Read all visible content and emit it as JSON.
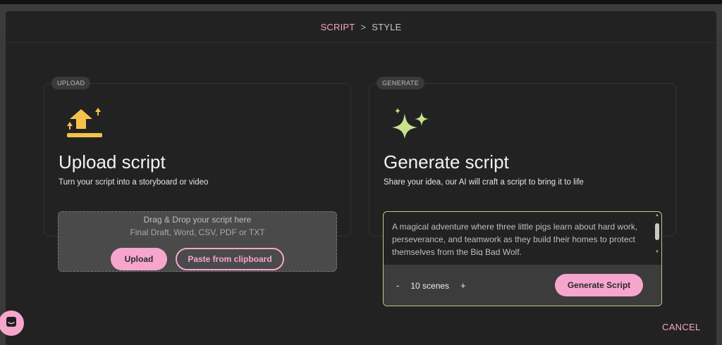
{
  "breadcrumb": {
    "step1": "SCRIPT",
    "separator": ">",
    "step2": "STYLE"
  },
  "upload_card": {
    "badge": "UPLOAD",
    "icon": "upload-arrow-icon",
    "title": "Upload script",
    "subtitle": "Turn your script into a storyboard or video",
    "dropzone_line1": "Drag & Drop your script here",
    "dropzone_line2": "Final Draft, Word, CSV, PDF or TXT",
    "upload_label": "Upload",
    "paste_label": "Paste from clipboard"
  },
  "generate_card": {
    "badge": "GENERATE",
    "icon": "sparkles-icon",
    "title": "Generate script",
    "subtitle": "Share your idea, our AI will craft a script to bring it to life",
    "idea_text": "A magical adventure where three little pigs learn about hard work, perseverance, and teamwork as they build their homes to protect themselves from the Big Bad Wolf.",
    "decrement_label": "-",
    "scenes_label": "10 scenes",
    "increment_label": "+",
    "generate_label": "Generate Script"
  },
  "footer": {
    "cancel_label": "CANCEL"
  },
  "chat": {
    "icon": "chat-icon"
  },
  "colors": {
    "accent": "#f6a6cc",
    "icon_yellow": "#f5c14b",
    "sparkle_green": "#c6e28c",
    "focus_border": "#b9c98c"
  }
}
